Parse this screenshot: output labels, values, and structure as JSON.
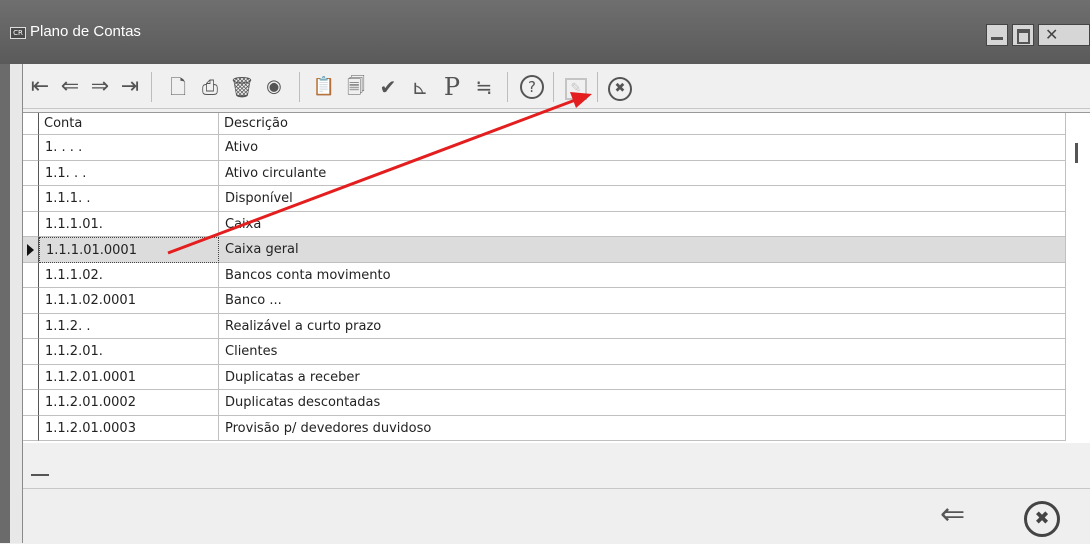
{
  "window": {
    "title": "Plano de Contas",
    "icon_text": "CR"
  },
  "toolbar": {
    "buttons": [
      {
        "name": "first-record",
        "glyph": "⇤"
      },
      {
        "name": "prev-record",
        "glyph": "⇐"
      },
      {
        "name": "next-record",
        "glyph": "⇒"
      },
      {
        "name": "last-record",
        "glyph": "⇥"
      },
      {
        "name": "new-document",
        "glyph": "🗋"
      },
      {
        "name": "print",
        "glyph": "⎙"
      },
      {
        "name": "delete",
        "glyph": "🗑"
      },
      {
        "name": "view",
        "glyph": "◉"
      },
      {
        "name": "clipboard",
        "glyph": "📋"
      },
      {
        "name": "copy",
        "glyph": "🗐"
      },
      {
        "name": "confirm",
        "glyph": "✔"
      },
      {
        "name": "tree",
        "glyph": "⊾"
      },
      {
        "name": "p-button",
        "glyph": "P"
      },
      {
        "name": "filter",
        "glyph": "≒"
      },
      {
        "name": "help",
        "glyph": "?"
      },
      {
        "name": "edit-disabled",
        "glyph": "✎"
      },
      {
        "name": "close-toolbar",
        "glyph": "✖"
      }
    ]
  },
  "grid": {
    "columns": [
      "Conta",
      "Descrição"
    ],
    "rows": [
      {
        "conta": "1. . . .",
        "descricao": "Ativo"
      },
      {
        "conta": "1.1. . .",
        "descricao": "Ativo circulante"
      },
      {
        "conta": "1.1.1. .",
        "descricao": "Disponível"
      },
      {
        "conta": "1.1.1.01.",
        "descricao": "Caixa"
      },
      {
        "conta": "1.1.1.01.0001",
        "descricao": "Caixa geral"
      },
      {
        "conta": "1.1.1.02.",
        "descricao": "Bancos conta movimento"
      },
      {
        "conta": "1.1.1.02.0001",
        "descricao": "Banco ..."
      },
      {
        "conta": "1.1.2. .",
        "descricao": "Realizável a curto prazo"
      },
      {
        "conta": "1.1.2.01.",
        "descricao": "Clientes"
      },
      {
        "conta": "1.1.2.01.0001",
        "descricao": "Duplicatas a receber"
      },
      {
        "conta": "1.1.2.01.0002",
        "descricao": "Duplicatas descontadas"
      },
      {
        "conta": "1.1.2.01.0003",
        "descricao": "Provisão p/ devedores duvidoso"
      }
    ],
    "selected_row": 4
  },
  "bottom": {
    "back_glyph": "⇐",
    "close_glyph": "✖"
  },
  "colors": {
    "titlebar": "#5f5f5f",
    "annotation_arrow": "#e41e1e",
    "selected_row": "#dcdcdc"
  }
}
